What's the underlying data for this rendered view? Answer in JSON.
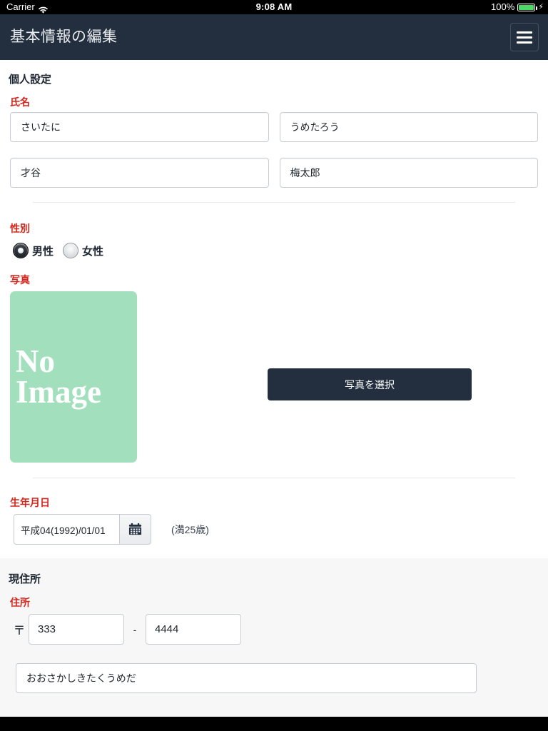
{
  "statusbar": {
    "carrier": "Carrier",
    "wifi_icon": "wifi-icon",
    "time": "9:08 AM",
    "battery_percent": "100%",
    "battery_icon": "battery-full-icon",
    "charging_icon": "lightning-bolt-icon"
  },
  "navbar": {
    "title": "基本情報の編集",
    "menu_icon": "hamburger-menu-icon"
  },
  "personal": {
    "section_title": "個人設定",
    "name_label": "氏名",
    "name_kana_last": "さいたに",
    "name_kana_first": "うめたろう",
    "name_kanji_last": "才谷",
    "name_kanji_first": "梅太郎",
    "gender_label": "性別",
    "gender_options": [
      {
        "label": "男性",
        "selected": true
      },
      {
        "label": "女性",
        "selected": false
      }
    ],
    "photo_label": "写真",
    "photo_placeholder_line1": "No",
    "photo_placeholder_line2": "Image",
    "photo_button": "写真を選択",
    "birthday_label": "生年月日",
    "birthday_value": "平成04(1992)/01/01",
    "calendar_icon": "calendar-icon",
    "age_note": "(満25歳)"
  },
  "address": {
    "section_title": "現住所",
    "address_label": "住所",
    "postal_mark": "〒",
    "postal_first": "333",
    "postal_separator": "-",
    "postal_second": "4444",
    "address_kana": "おおさかしきたくうめだ"
  },
  "colors": {
    "navbar": "#232f3f",
    "required_label": "#d3261c",
    "photo_placeholder_bg": "#a2e0bd",
    "battery_green": "#4cd964",
    "page_bg": "#ffffff",
    "section_gray_bg": "#f7f7f8"
  }
}
